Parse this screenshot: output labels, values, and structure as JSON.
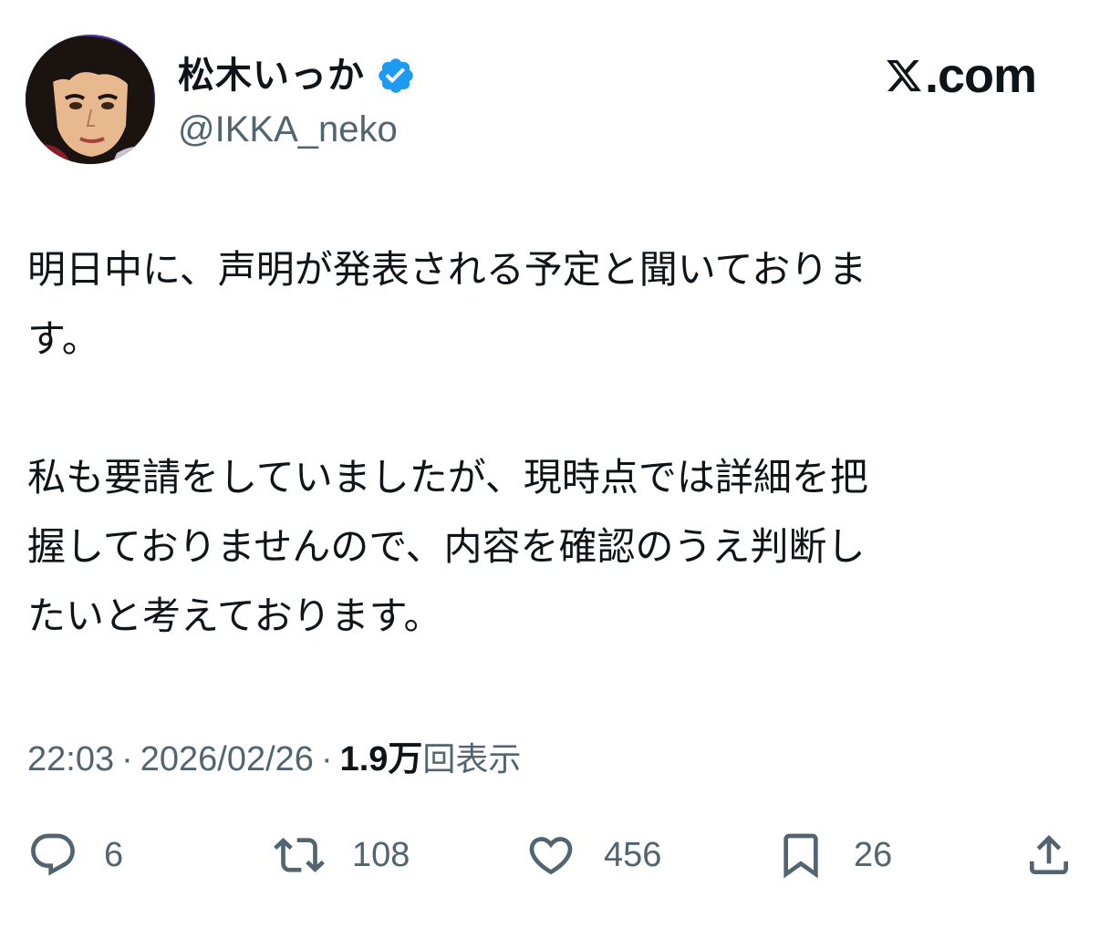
{
  "author": {
    "display_name": "松木いっか",
    "handle": "@IKKA_neko",
    "verified": true,
    "avatar_icon": "avatar-illustration"
  },
  "brand": {
    "label": ".com",
    "icon": "x-logo-icon"
  },
  "post": {
    "paragraphs": [
      {
        "lines": [
          "明日中に、声明が発表される予定と聞いておりま",
          "す。"
        ]
      },
      {
        "lines": [
          "私も要請をしていましたが、現時点では詳細を把",
          "握しておりませんので、内容を確認のうえ判断し",
          "たいと考えております。"
        ]
      }
    ]
  },
  "meta": {
    "time": "22:03",
    "separator": "·",
    "date": "2026/02/26",
    "views_count": "1.9万",
    "views_label": "回表示"
  },
  "actions": {
    "reply": {
      "icon": "reply-icon",
      "count": "6"
    },
    "repost": {
      "icon": "repost-icon",
      "count": "108"
    },
    "like": {
      "icon": "heart-icon",
      "count": "456"
    },
    "bookmark": {
      "icon": "bookmark-icon",
      "count": "26"
    },
    "share": {
      "icon": "share-icon"
    }
  },
  "colors": {
    "text_primary": "#0f1419",
    "text_secondary": "#536471",
    "verified_blue": "#1d9bf0",
    "background": "#ffffff"
  }
}
